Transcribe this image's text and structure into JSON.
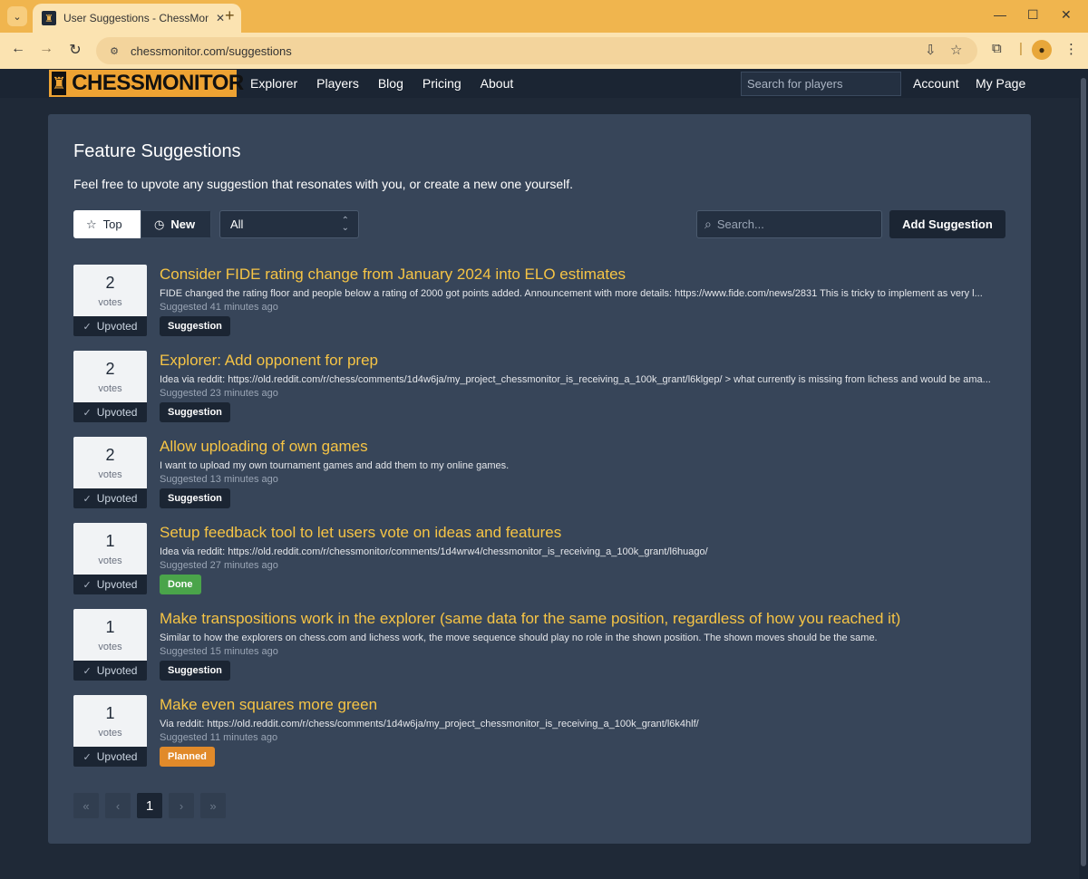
{
  "browser": {
    "tab_title": "User Suggestions - ChessMonitor",
    "url": "chessmonitor.com/suggestions"
  },
  "header": {
    "logo_text": "CHESSMONITOR",
    "nav": [
      "Explorer",
      "Players",
      "Blog",
      "Pricing",
      "About"
    ],
    "search_placeholder": "Search for players",
    "account": "Account",
    "my_page": "My Page"
  },
  "page": {
    "title": "Feature Suggestions",
    "description": "Feel free to upvote any suggestion that resonates with you, or create a new one yourself.",
    "sort_top": "Top",
    "sort_new": "New",
    "filter_value": "All",
    "search_placeholder": "Search...",
    "add_button": "Add Suggestion"
  },
  "suggestions": [
    {
      "votes": "2",
      "votes_label": "votes",
      "upvoted": "Upvoted",
      "title": "Consider FIDE rating change from January 2024 into ELO estimates",
      "description": "FIDE changed the rating floor and people below a rating of 2000 got points added. Announcement with more details: https://www.fide.com/news/2831 This is tricky to implement as very l...",
      "meta": "Suggested 41 minutes ago",
      "status": "Suggestion"
    },
    {
      "votes": "2",
      "votes_label": "votes",
      "upvoted": "Upvoted",
      "title": "Explorer: Add opponent for prep",
      "description": "Idea via reddit: https://old.reddit.com/r/chess/comments/1d4w6ja/my_project_chessmonitor_is_receiving_a_100k_grant/l6klgep/ > what currently is missing from lichess and would be ama...",
      "meta": "Suggested 23 minutes ago",
      "status": "Suggestion"
    },
    {
      "votes": "2",
      "votes_label": "votes",
      "upvoted": "Upvoted",
      "title": "Allow uploading of own games",
      "description": "I want to upload my own tournament games and add them to my online games.",
      "meta": "Suggested 13 minutes ago",
      "status": "Suggestion"
    },
    {
      "votes": "1",
      "votes_label": "votes",
      "upvoted": "Upvoted",
      "title": "Setup feedback tool to let users vote on ideas and features",
      "description": "Idea via reddit: https://old.reddit.com/r/chessmonitor/comments/1d4wrw4/chessmonitor_is_receiving_a_100k_grant/l6huago/",
      "meta": "Suggested 27 minutes ago",
      "status": "Done"
    },
    {
      "votes": "1",
      "votes_label": "votes",
      "upvoted": "Upvoted",
      "title": "Make transpositions work in the explorer (same data for the same position, regardless of how you reached it)",
      "description": "Similar to how the explorers on chess.com and lichess work, the move sequence should play no role in the shown position. The shown moves should be the same.",
      "meta": "Suggested 15 minutes ago",
      "status": "Suggestion"
    },
    {
      "votes": "1",
      "votes_label": "votes",
      "upvoted": "Upvoted",
      "title": "Make even squares more green",
      "description": "Via reddit: https://old.reddit.com/r/chess/comments/1d4w6ja/my_project_chessmonitor_is_receiving_a_100k_grant/l6k4hlf/",
      "meta": "Suggested 11 minutes ago",
      "status": "Planned"
    }
  ],
  "pagination": {
    "first": "«",
    "prev": "‹",
    "current": "1",
    "next": "›",
    "last": "»"
  },
  "colors": {
    "accent": "#f6c445",
    "brand_orange": "#eea333",
    "done": "#4aa44a",
    "planned": "#e18a2a"
  }
}
